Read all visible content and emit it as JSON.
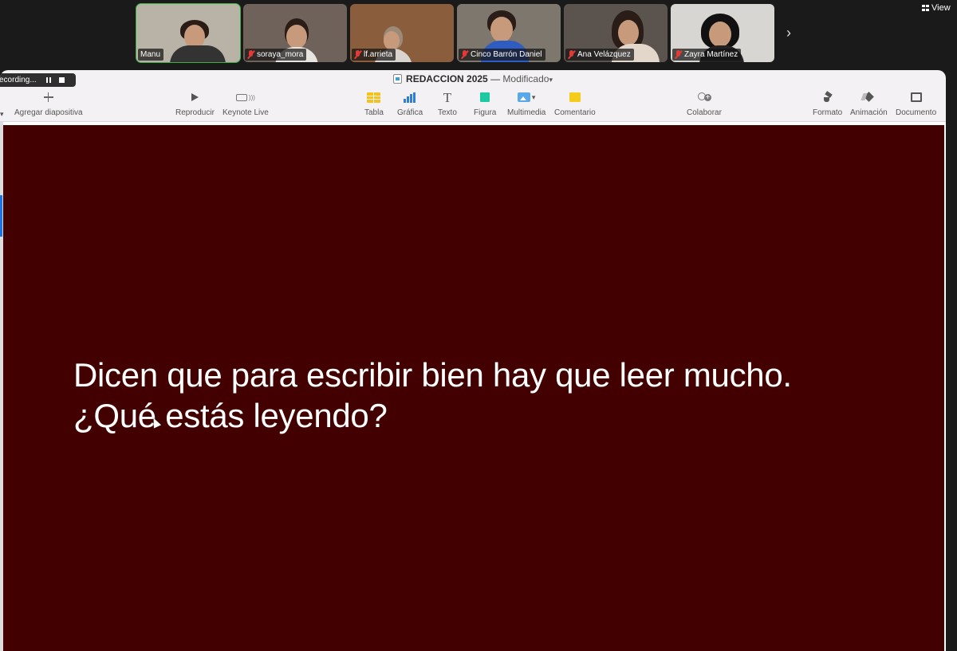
{
  "meeting": {
    "participants": [
      {
        "name": "Manu",
        "muted": false,
        "active": true,
        "bg": "#b9b2a6",
        "body": "#333"
      },
      {
        "name": "soraya_mora",
        "muted": true,
        "active": false,
        "bg": "#6e625a",
        "body": "#e8e4e0"
      },
      {
        "name": "lf.arrieta",
        "muted": true,
        "active": false,
        "bg": "#8a5d3d",
        "body": "#d9d4cf"
      },
      {
        "name": "Cinco Barrón Daniel",
        "muted": true,
        "active": false,
        "bg": "#7d776e",
        "body": "#2f5cc0"
      },
      {
        "name": "Ana Velázquez",
        "muted": true,
        "active": false,
        "bg": "#5b534d",
        "body": "#e3d6cb"
      },
      {
        "name": "Zayra Martínez",
        "muted": true,
        "active": false,
        "bg": "#d8d6d2",
        "body": "#222"
      }
    ],
    "view_label": "View",
    "recording_label": "ecording..."
  },
  "keynote": {
    "document_title": "REDACCION 2025",
    "title_separator": " — ",
    "document_status": "Modificado",
    "toolbar": {
      "add_slide": "Agregar diapositiva",
      "play": "Reproducir",
      "keynote_live": "Keynote Live",
      "table": "Tabla",
      "chart": "Gráfica",
      "text": "Texto",
      "shape": "Figura",
      "media": "Multimedia",
      "comment": "Comentario",
      "collaborate": "Colaborar",
      "format": "Formato",
      "animate": "Animación",
      "document": "Documento"
    },
    "slide": {
      "line1": "Dicen que para escribir bien hay que leer mucho.",
      "line2": "¿Qué estás leyendo?",
      "background": "#420000",
      "text_color": "#ffffff"
    }
  }
}
